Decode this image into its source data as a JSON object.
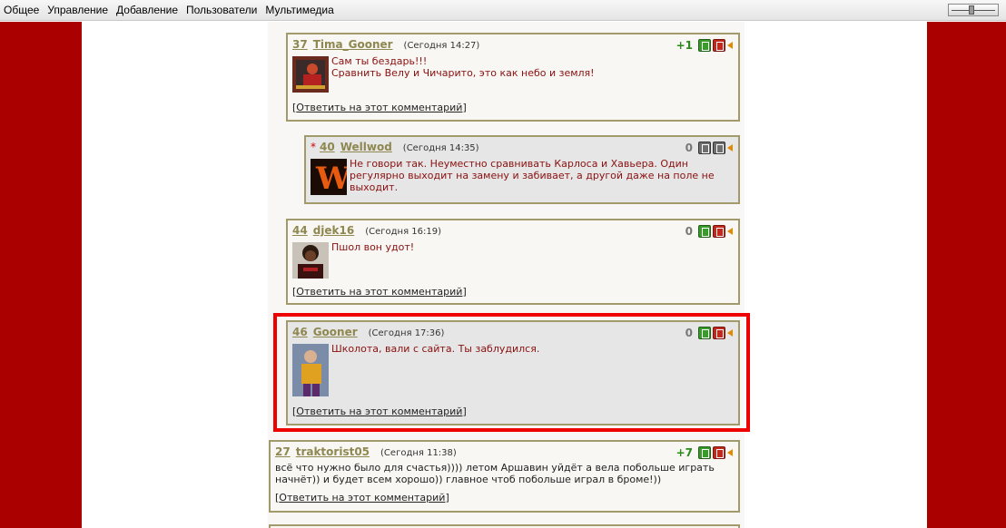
{
  "menu": [
    "Общее",
    "Управление",
    "Добавление",
    "Пользователи",
    "Мультимедиа"
  ],
  "comments": [
    {
      "num": "37",
      "author": "Tima_Gooner",
      "time": "(Сегодня 14:27)",
      "score": "+1",
      "lines": [
        "Сам ты бездарь!!!",
        "Сравнить Велу и Чичарито, это как небо и земля!"
      ],
      "reply": "Ответить на этот комментарий"
    },
    {
      "num": "40",
      "author": "Wellwod",
      "time": "(Сегодня 14:35)",
      "score": "0",
      "star": "*",
      "lines": [
        "Не говори так. Неуместно сравнивать Карлоса и Хавьера. Один",
        "регулярно выходит на замену и забивает, а другой даже на поле не",
        "выходит."
      ]
    },
    {
      "num": "44",
      "author": "djek16",
      "time": "(Сегодня 16:19)",
      "score": "0",
      "lines": [
        "Пшол вон удот!"
      ],
      "reply": "Ответить на этот комментарий"
    },
    {
      "num": "46",
      "author": "Gooner",
      "time": "(Сегодня 17:36)",
      "score": "0",
      "lines": [
        "Школота, вали с сайта. Ты заблудился."
      ],
      "reply": "Ответить на этот комментарий"
    },
    {
      "num": "27",
      "author": "traktorist05",
      "time": "(Сегодня 11:38)",
      "score": "+7",
      "lines": [
        "всё что нужно было для счастья)))) летом Аршавин уйдёт а вела побольше играть",
        "начнёт)) и будет всем хорошо)) главное чтоб побольше играл в броме!))"
      ],
      "reply": "Ответить на этот комментарий"
    }
  ],
  "colors": {
    "band": "#aa0000",
    "highlight": "#ee0000",
    "author": "#8e8750",
    "text": "#8a1010",
    "positive": "#2a8b1c"
  },
  "icons": {
    "vote_up": "thumb-up-icon",
    "vote_down": "thumb-down-icon",
    "report": "flag-icon",
    "slider": "zoom-slider"
  }
}
